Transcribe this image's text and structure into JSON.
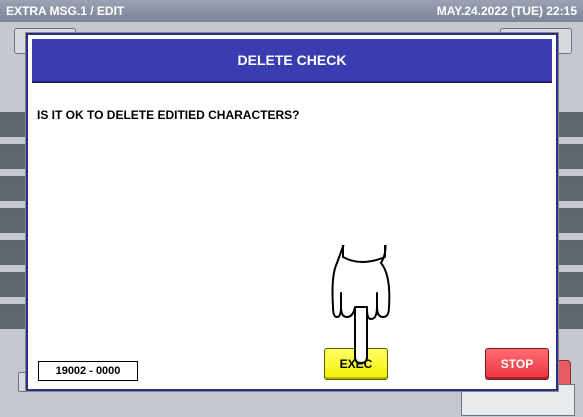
{
  "header": {
    "screen_title": "EXTRA MSG.1 / EDIT",
    "datetime": "MAY.24.2022 (TUE)  22:15"
  },
  "dialog": {
    "title": "DELETE CHECK",
    "message": "IS IT OK TO DELETE EDITIED CHARACTERS?",
    "code": "19002 - 0000",
    "exec_label": "EXEC",
    "stop_label": "STOP"
  },
  "colors": {
    "title_bar": "#3a3db0",
    "exec_button": "#f2f000",
    "stop_button": "#ec3540"
  },
  "icons": {
    "pointer": "pointing-hand-icon"
  }
}
